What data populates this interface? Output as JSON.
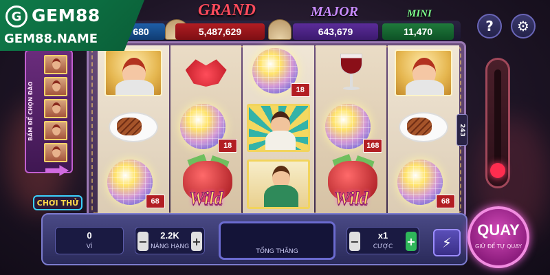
{
  "logo": {
    "mark": "G",
    "name": "GEM88",
    "domain": "GEM88.NAME"
  },
  "jackpots": {
    "grand": {
      "label": "GRAND",
      "value": "5,487,629"
    },
    "major": {
      "label": "MAJOR",
      "value": "643,679"
    },
    "mini": {
      "label": "MINI",
      "value": "11,470"
    },
    "minor": {
      "value": "680"
    }
  },
  "top_buttons": {
    "help_icon": "question-icon",
    "help_glyph": "?",
    "settings_icon": "gear-icon",
    "settings_glyph": "⚙"
  },
  "side_panel": {
    "text": "BẤM ĐỂ CHỌN ĐÀO",
    "try_label": "CHƠI THỬ"
  },
  "reels": [
    [
      {
        "symbol": "woman-sailor-icon"
      },
      {
        "symbol": "steak-plate-icon"
      },
      {
        "symbol": "disco-ball-icon",
        "multiplier": "68"
      }
    ],
    [
      {
        "symbol": "lips-icon"
      },
      {
        "symbol": "disco-ball-icon",
        "multiplier": "18"
      },
      {
        "symbol": "wild-money-bag-icon",
        "label": "Wild"
      }
    ],
    [
      {
        "symbol": "disco-ball-icon",
        "multiplier": "18"
      },
      {
        "symbol": "singer-woman-icon"
      },
      {
        "symbol": "waitress-woman-icon"
      }
    ],
    [
      {
        "symbol": "wine-glass-icon"
      },
      {
        "symbol": "disco-ball-icon",
        "multiplier": "168"
      },
      {
        "symbol": "wild-money-bag-icon",
        "label": "Wild"
      }
    ],
    [
      {
        "symbol": "woman-sailor-icon"
      },
      {
        "symbol": "steak-plate-icon"
      },
      {
        "symbol": "disco-ball-icon",
        "multiplier": "68"
      }
    ]
  ],
  "ways": "243",
  "controls": {
    "balance": {
      "value": "0",
      "label": "VÍ"
    },
    "bet_level": {
      "value": "2.2K",
      "label": "NÂNG HẠNG"
    },
    "total_win": {
      "value": "",
      "label": "TỔNG THẮNG"
    },
    "bet": {
      "value": "x1",
      "label": "CƯỢC"
    },
    "turbo_icon": "lightning-icon",
    "turbo_glyph": "⚡",
    "spin": {
      "label": "QUAY",
      "sub": "GIỮ ĐỂ TỰ QUAY"
    }
  },
  "colors": {
    "logo_bg": "#0f7b4a",
    "grand": "#b11d22",
    "major": "#5b2c9a",
    "mini": "#1f7a3b",
    "spin": "#8d1d7e"
  }
}
